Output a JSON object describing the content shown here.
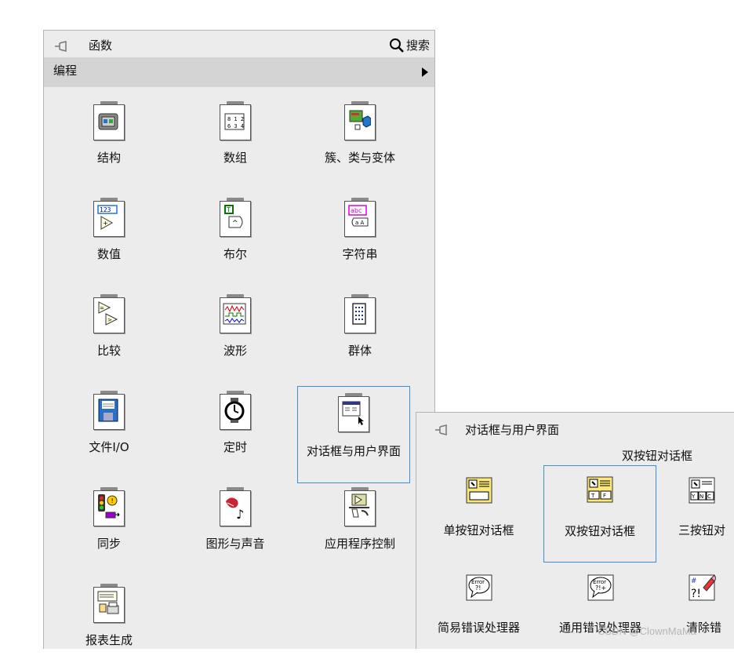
{
  "palette": {
    "title": "函数",
    "search_label": "搜索",
    "category": "编程",
    "items": [
      {
        "label": "结构"
      },
      {
        "label": "数组"
      },
      {
        "label": "簇、类与变体"
      },
      {
        "label": "数值"
      },
      {
        "label": "布尔"
      },
      {
        "label": "字符串"
      },
      {
        "label": "比较"
      },
      {
        "label": "波形"
      },
      {
        "label": "群体"
      },
      {
        "label": "文件I/O"
      },
      {
        "label": "定时"
      },
      {
        "label": "对话框与用户界面"
      },
      {
        "label": "同步"
      },
      {
        "label": "图形与声音"
      },
      {
        "label": "应用程序控制"
      },
      {
        "label": "报表生成"
      }
    ]
  },
  "dialog_palette": {
    "title": "对话框与用户界面",
    "tooltip": "双按钮对话框",
    "items": [
      {
        "label": "单按钮对话框"
      },
      {
        "label": "双按钮对话框"
      },
      {
        "label": "三按钮对"
      },
      {
        "label": "简易错误处理器"
      },
      {
        "label": "通用错误处理器"
      },
      {
        "label": "清除错"
      }
    ]
  },
  "watermark": "CSDN @ClownMaMa"
}
